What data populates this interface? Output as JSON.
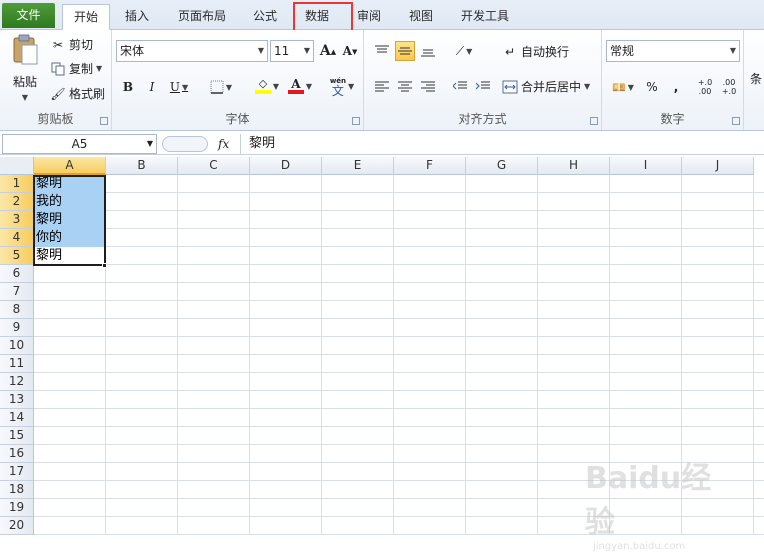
{
  "tabs": [
    {
      "label": "文件"
    },
    {
      "label": "开始"
    },
    {
      "label": "插入"
    },
    {
      "label": "页面布局"
    },
    {
      "label": "公式"
    },
    {
      "label": "数据"
    },
    {
      "label": "审阅"
    },
    {
      "label": "视图"
    },
    {
      "label": "开发工具"
    }
  ],
  "colors": {
    "file_tab": "#2e7a1f",
    "highlight": "#e53935",
    "selection": "#a9d1f4",
    "header_selected": "#f6cd5f",
    "font_color_bar": "#e0191f",
    "fill_color_bar": "#ffff00"
  },
  "ribbon": {
    "clipboard": {
      "title": "剪贴板",
      "paste": "粘贴",
      "cut": "剪切",
      "copy": "复制",
      "format_painter": "格式刷"
    },
    "font": {
      "title": "字体",
      "font_name": "宋体",
      "font_size": "11",
      "bold": "B",
      "italic": "I",
      "underline": "U",
      "grow": "A",
      "shrink": "A",
      "color_letter": "A",
      "wen": "文",
      "wen_sup": "wén"
    },
    "alignment": {
      "title": "对齐方式",
      "wrap_text": "自动换行",
      "merge_center": "合并后居中"
    },
    "number": {
      "title": "数字",
      "format": "常规",
      "percent": "%",
      "comma": ",",
      "inc_decimal": "+.0\n.00",
      "dec_decimal": ".00\n+.0"
    },
    "styles": {
      "title": "条"
    }
  },
  "formula_bar": {
    "name_box": "A5",
    "fx": "fx",
    "content": "黎明"
  },
  "columns": [
    "A",
    "B",
    "C",
    "D",
    "E",
    "F",
    "G",
    "H",
    "I",
    "J"
  ],
  "rows": [
    "1",
    "2",
    "3",
    "4",
    "5",
    "6",
    "7",
    "8",
    "9",
    "10",
    "11",
    "12",
    "13",
    "14",
    "15",
    "16",
    "17",
    "18",
    "19",
    "20"
  ],
  "cells": [
    {
      "ref": "A1",
      "value": "黎明"
    },
    {
      "ref": "A2",
      "value": "我的"
    },
    {
      "ref": "A3",
      "value": "黎明"
    },
    {
      "ref": "A4",
      "value": "你的"
    },
    {
      "ref": "A5",
      "value": "黎明"
    }
  ],
  "watermark": {
    "logo": "Baidu经验",
    "sub": "jingyan.baidu.com"
  }
}
